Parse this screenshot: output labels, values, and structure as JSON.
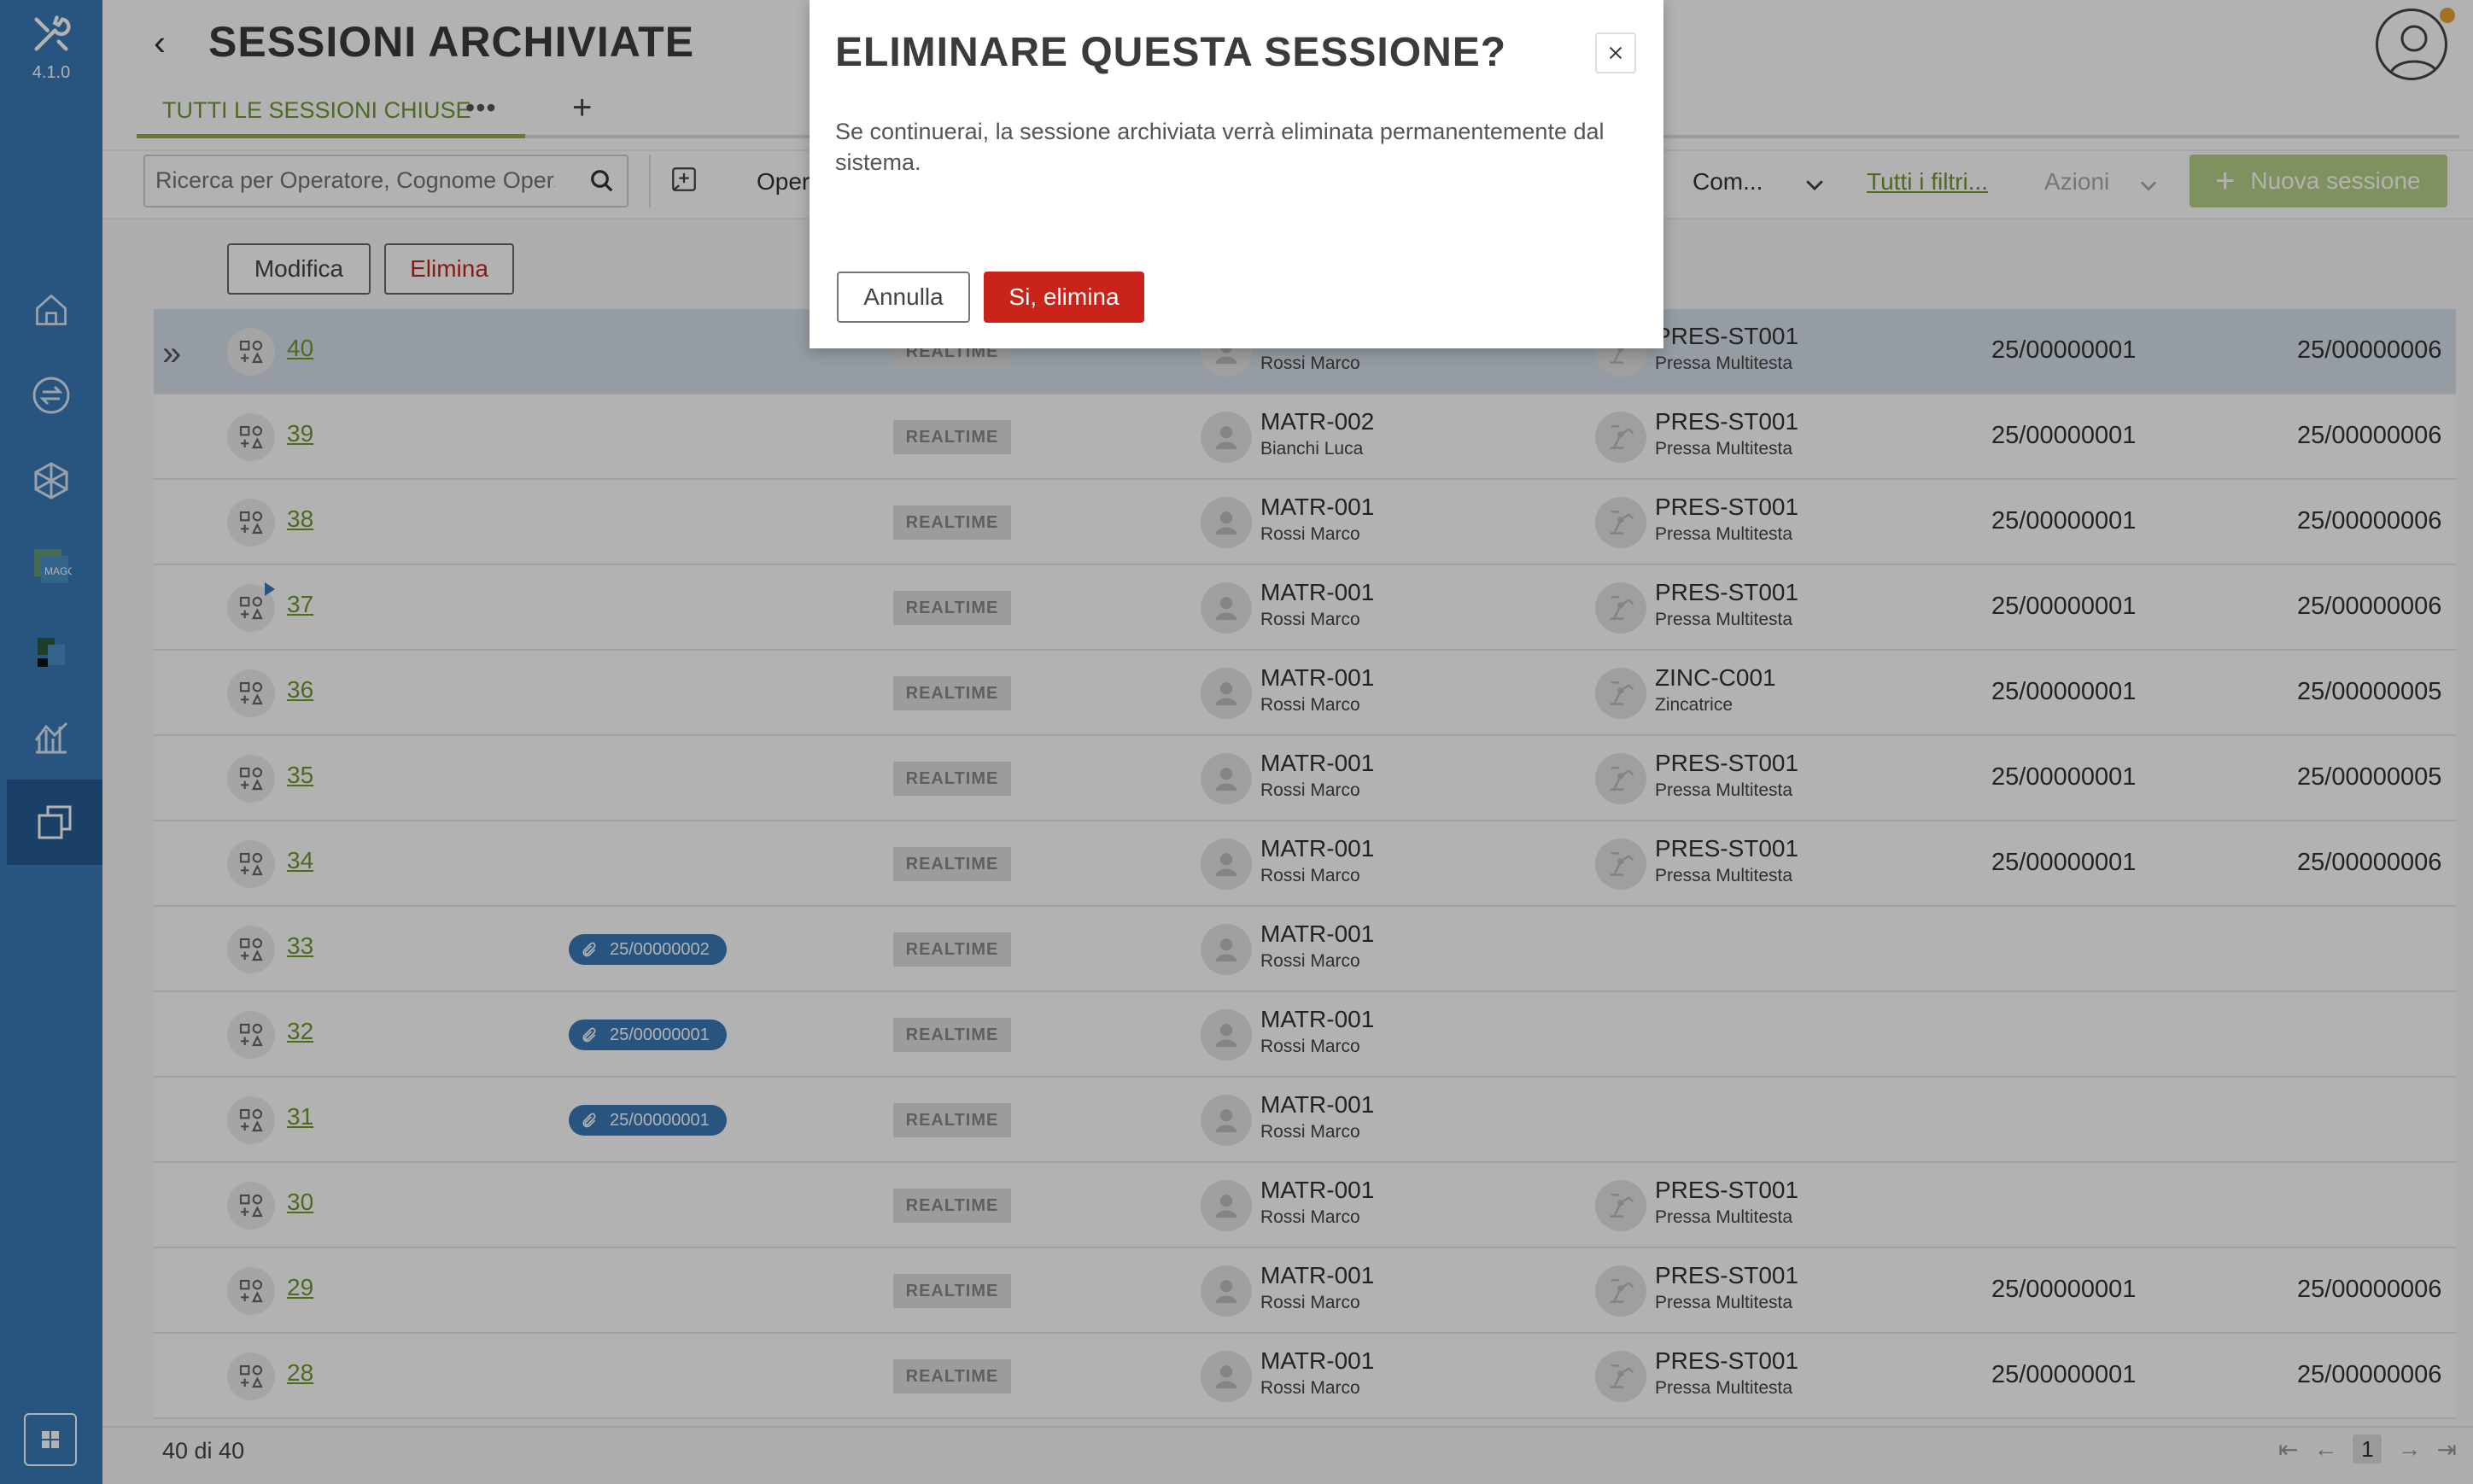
{
  "app": {
    "version": "4.1.0",
    "page_title": "SESSIONI ARCHIVIATE"
  },
  "tabs": [
    {
      "label": "TUTTI LE SESSIONI CHIUSE"
    }
  ],
  "toolbar": {
    "search_placeholder": "Ricerca per Operatore, Cognome Oper...",
    "operator_label": "Oper",
    "com_label": "Com...",
    "filters_link": "Tutti i filtri...",
    "actions_label": "Azioni",
    "new_session_label": "Nuova sessione"
  },
  "actions": {
    "edit_label": "Modifica",
    "delete_label": "Elimina"
  },
  "rows": [
    {
      "id": "40",
      "badge": "REALTIME",
      "op_code": "",
      "op_name": "Rossi Marco",
      "mac_code": "PRES-ST001",
      "mac_name": "Pressa Multitesta",
      "c1": "25/00000001",
      "c2": "25/00000006"
    },
    {
      "id": "39",
      "badge": "REALTIME",
      "op_code": "MATR-002",
      "op_name": "Bianchi Luca",
      "mac_code": "PRES-ST001",
      "mac_name": "Pressa Multitesta",
      "c1": "25/00000001",
      "c2": "25/00000006"
    },
    {
      "id": "38",
      "badge": "REALTIME",
      "op_code": "MATR-001",
      "op_name": "Rossi Marco",
      "mac_code": "PRES-ST001",
      "mac_name": "Pressa Multitesta",
      "c1": "25/00000001",
      "c2": "25/00000006"
    },
    {
      "id": "37",
      "badge": "REALTIME",
      "op_code": "MATR-001",
      "op_name": "Rossi Marco",
      "mac_code": "PRES-ST001",
      "mac_name": "Pressa Multitesta",
      "c1": "25/00000001",
      "c2": "25/00000006"
    },
    {
      "id": "36",
      "badge": "REALTIME",
      "op_code": "MATR-001",
      "op_name": "Rossi Marco",
      "mac_code": "ZINC-C001",
      "mac_name": "Zincatrice",
      "c1": "25/00000001",
      "c2": "25/00000005"
    },
    {
      "id": "35",
      "badge": "REALTIME",
      "op_code": "MATR-001",
      "op_name": "Rossi Marco",
      "mac_code": "PRES-ST001",
      "mac_name": "Pressa Multitesta",
      "c1": "25/00000001",
      "c2": "25/00000005"
    },
    {
      "id": "34",
      "badge": "REALTIME",
      "op_code": "MATR-001",
      "op_name": "Rossi Marco",
      "mac_code": "PRES-ST001",
      "mac_name": "Pressa Multitesta",
      "c1": "25/00000001",
      "c2": "25/00000006"
    },
    {
      "id": "33",
      "order": "25/00000002",
      "badge": "REALTIME",
      "op_code": "MATR-001",
      "op_name": "Rossi Marco"
    },
    {
      "id": "32",
      "order": "25/00000001",
      "badge": "REALTIME",
      "op_code": "MATR-001",
      "op_name": "Rossi Marco"
    },
    {
      "id": "31",
      "order": "25/00000001",
      "badge": "REALTIME",
      "op_code": "MATR-001",
      "op_name": "Rossi Marco"
    },
    {
      "id": "30",
      "badge": "REALTIME",
      "op_code": "MATR-001",
      "op_name": "Rossi Marco",
      "mac_code": "PRES-ST001",
      "mac_name": "Pressa Multitesta"
    },
    {
      "id": "29",
      "badge": "REALTIME",
      "op_code": "MATR-001",
      "op_name": "Rossi Marco",
      "mac_code": "PRES-ST001",
      "mac_name": "Pressa Multitesta",
      "c1": "25/00000001",
      "c2": "25/00000006"
    },
    {
      "id": "28",
      "badge": "REALTIME",
      "op_code": "MATR-001",
      "op_name": "Rossi Marco",
      "mac_code": "PRES-ST001",
      "mac_name": "Pressa Multitesta",
      "c1": "25/00000001",
      "c2": "25/00000006"
    }
  ],
  "footer": {
    "count": "40 di 40",
    "page": "1"
  },
  "modal": {
    "title": "ELIMINARE QUESTA SESSIONE?",
    "body": "Se continuerai, la sessione archiviata verrà eliminata permanentemente dal sistema.",
    "cancel_label": "Annulla",
    "confirm_label": "Si, elimina"
  },
  "colors": {
    "rail": "#3a7ab8",
    "accent": "#8fb24b",
    "danger": "#c9231a",
    "pill": "#3a7ab8"
  },
  "icons": [
    "tools-icon",
    "home-icon",
    "sync-icon",
    "cube-icon",
    "mago-icon",
    "app-icon",
    "chart-icon",
    "copy-icon",
    "grid-icon",
    "search-icon",
    "add-bookmark-icon",
    "chevron-down-icon",
    "plus-icon",
    "close-icon",
    "user-icon",
    "paperclip-icon",
    "machine-icon",
    "session-type-icon",
    "expand-icon"
  ]
}
